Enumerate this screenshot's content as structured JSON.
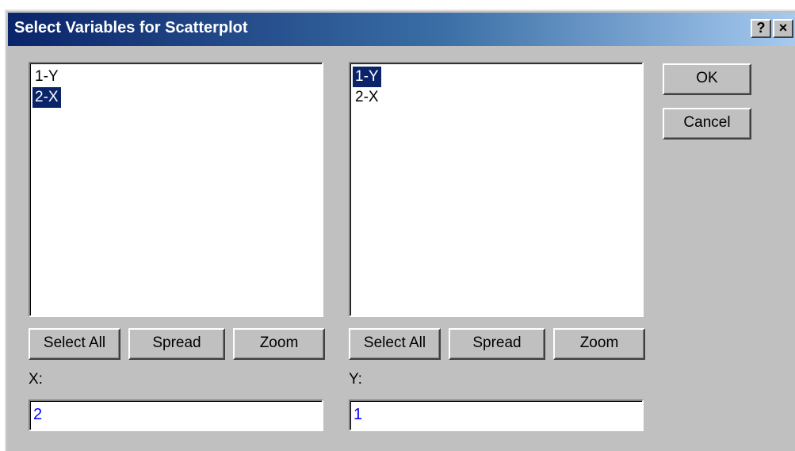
{
  "dialog": {
    "title": "Select Variables for Scatterplot",
    "help_label": "?",
    "close_label": "×"
  },
  "x_panel": {
    "items": [
      "1-Y",
      "2-X"
    ],
    "selected_item": "2-X",
    "select_all_label": "Select All",
    "spread_label": "Spread",
    "zoom_label": "Zoom",
    "field_label": "X:",
    "field_value": "2"
  },
  "y_panel": {
    "items": [
      "1-Y",
      "2-X"
    ],
    "selected_item": "1-Y",
    "select_all_label": "Select All",
    "spread_label": "Spread",
    "zoom_label": "Zoom",
    "field_label": "Y:",
    "field_value": "1"
  },
  "actions": {
    "ok_label": "OK",
    "cancel_label": "Cancel"
  },
  "colors": {
    "selection": "#0a246a",
    "field_text": "#0000ff",
    "face": "#c0c0c0"
  }
}
